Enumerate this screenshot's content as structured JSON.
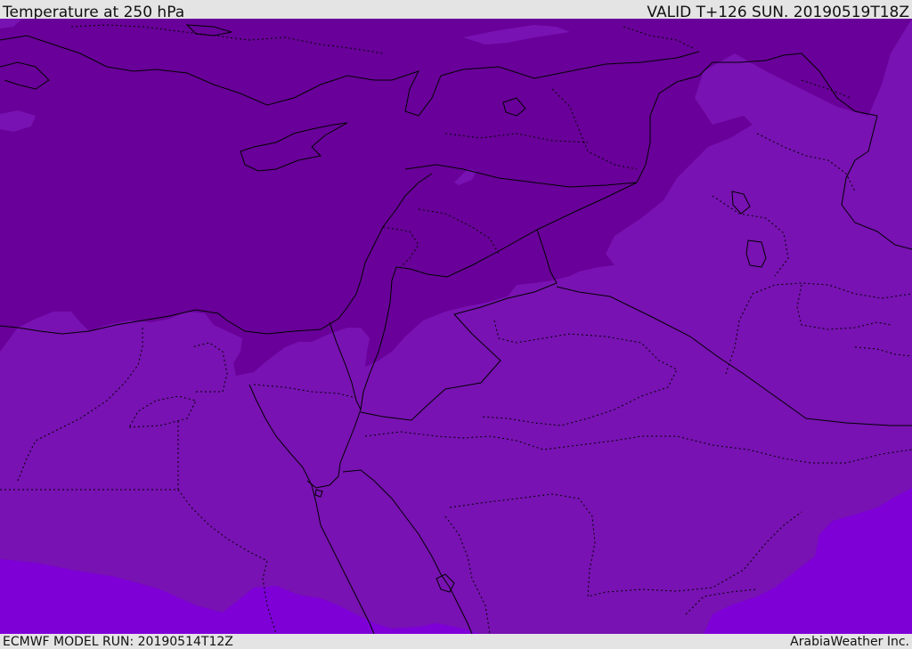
{
  "header": {
    "title": "Temperature at 250 hPa",
    "valid_time": "VALID T+126 SUN. 20190519T18Z"
  },
  "footer": {
    "model_run": "ECMWF MODEL RUN: 20190514T12Z",
    "credit": "ArabiaWeather Inc."
  },
  "map": {
    "region": "Eastern Mediterranean / Levant / Northern Arabia",
    "colors": {
      "dark_band": "#690099",
      "mid_band": "#7812b2",
      "light_band": "#7e00d7",
      "coastline": "#000000",
      "borders": "#000000"
    }
  }
}
